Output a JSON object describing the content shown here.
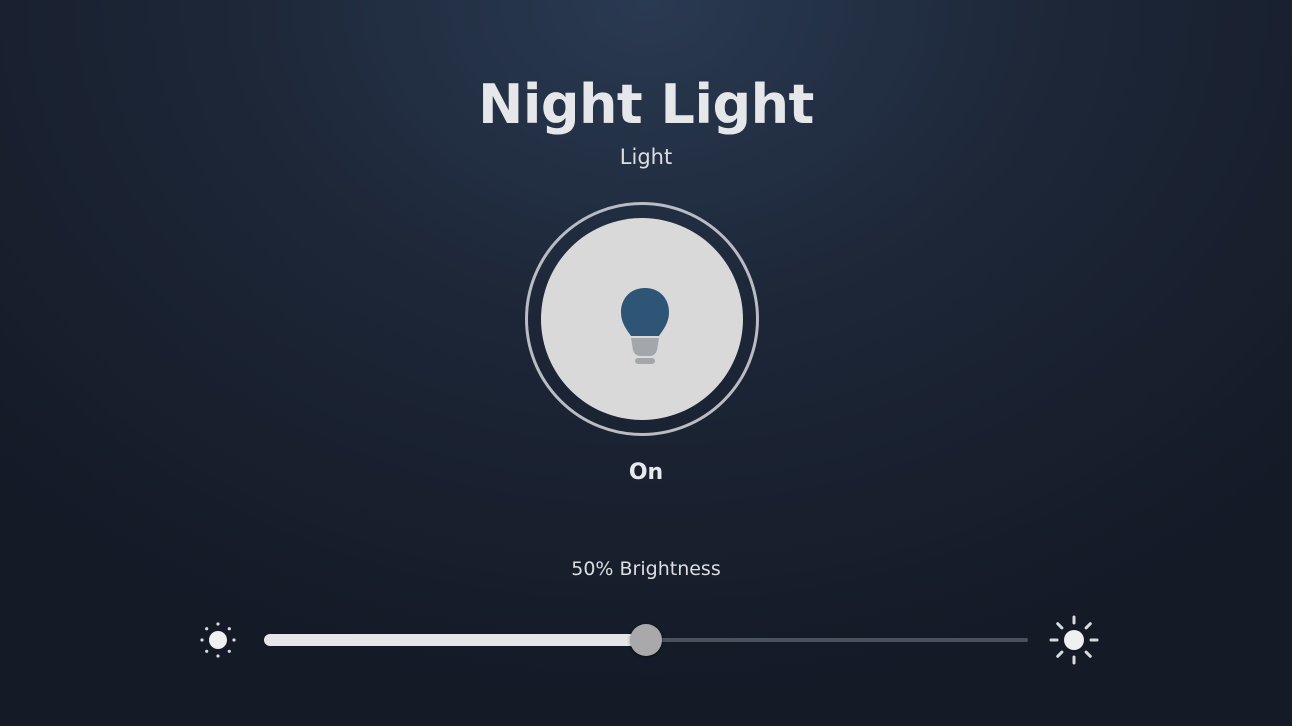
{
  "device": {
    "name": "Night Light",
    "type": "Light",
    "state": "On"
  },
  "power_button": {
    "icon": "lightbulb-icon",
    "bulb_color": "#2e5476",
    "base_color": "#a3a6ab"
  },
  "brightness": {
    "label": "50% Brightness",
    "value": 50,
    "min_icon": "brightness-low-icon",
    "max_icon": "brightness-high-icon"
  }
}
